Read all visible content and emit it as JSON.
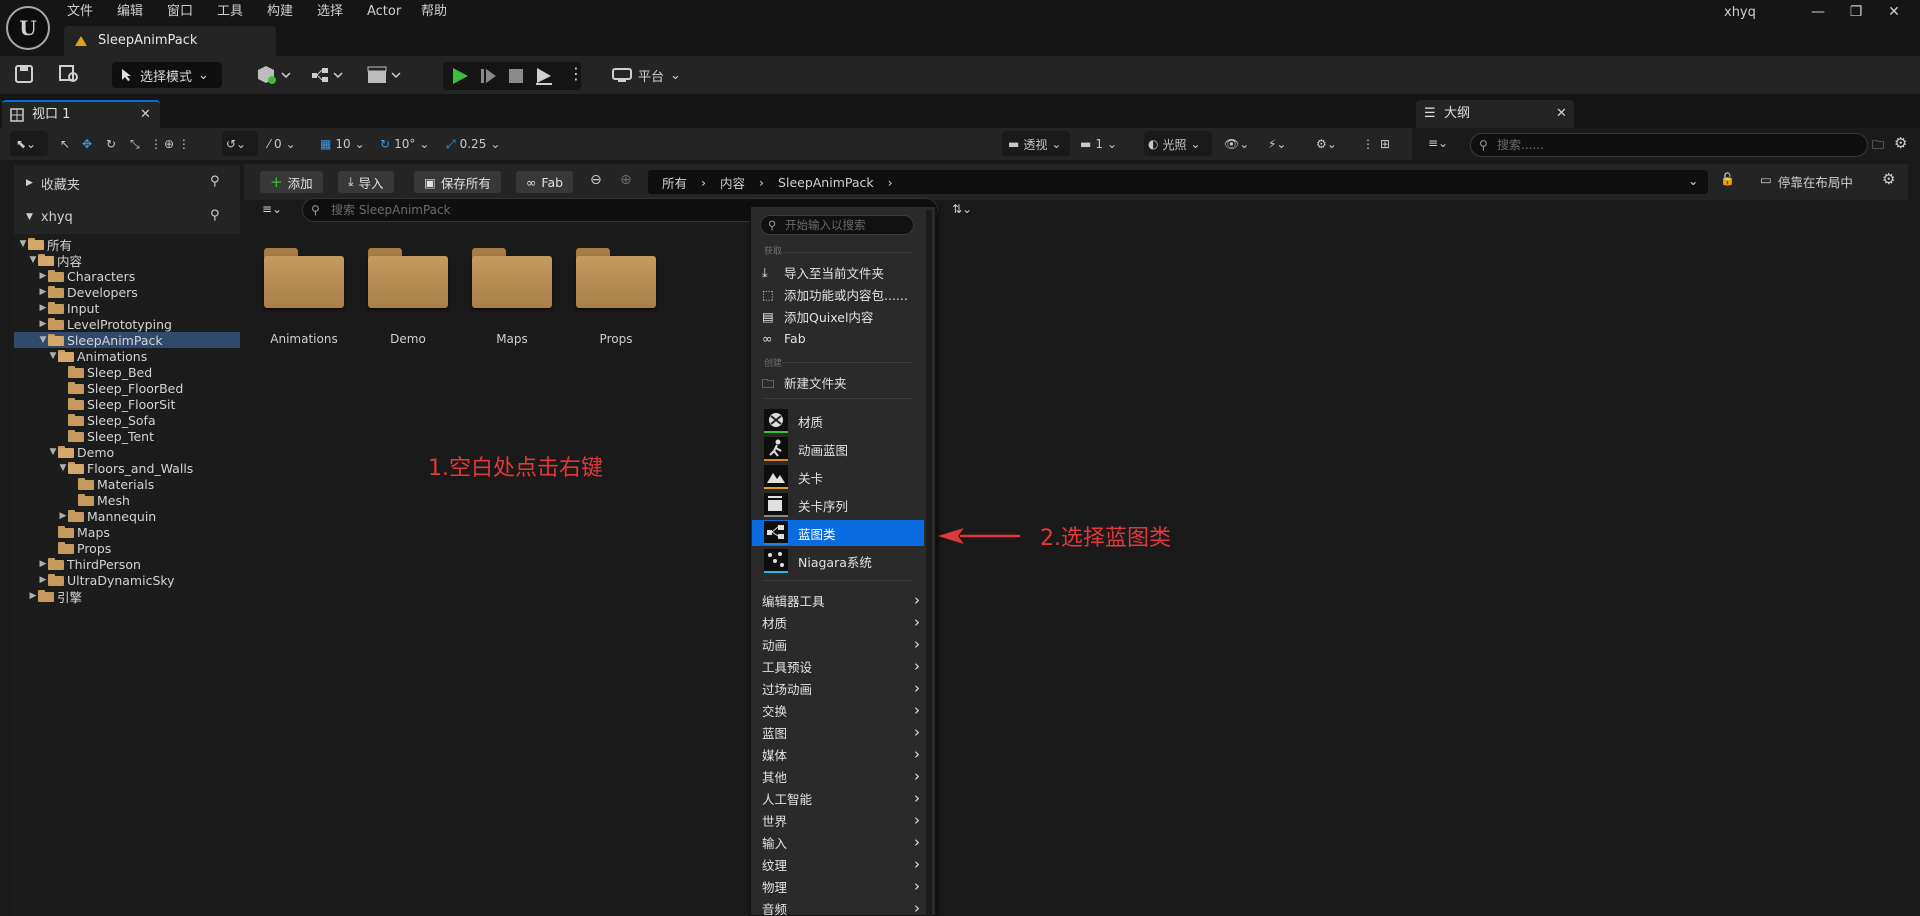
{
  "menubar": {
    "items": [
      "文件",
      "编辑",
      "窗口",
      "工具",
      "构建",
      "选择",
      "Actor",
      "帮助"
    ],
    "user": "xhyq",
    "project_tab": "SleepAnimPack"
  },
  "toolbar": {
    "mode_select": "选择模式",
    "platform": "平台"
  },
  "viewport": {
    "tab_title": "视口 1",
    "rotation_snap": "0",
    "grid_snap": "10",
    "angle_snap": "10°",
    "scale_snap": "0.25",
    "view_mode": "透视",
    "speed": "1",
    "lighting": "光照"
  },
  "outliner": {
    "tab_title": "大纲",
    "search_placeholder": "搜索......"
  },
  "content_browser": {
    "favorites": "收藏夹",
    "root": "xhyq",
    "buttons": {
      "add": "添加",
      "import": "导入",
      "save_all": "保存所有",
      "fab": "Fab"
    },
    "path": [
      "所有",
      "内容",
      "SleepAnimPack"
    ],
    "dock_label": "停靠在布局中",
    "search_placeholder": "搜索 SleepAnimPack",
    "tree": [
      {
        "label": "所有",
        "depth": 0,
        "expanded": true,
        "selected": false,
        "arrow": true
      },
      {
        "label": "内容",
        "depth": 1,
        "expanded": true,
        "selected": false,
        "arrow": true
      },
      {
        "label": "Characters",
        "depth": 2,
        "expanded": false,
        "selected": false,
        "arrow": true
      },
      {
        "label": "Developers",
        "depth": 2,
        "expanded": false,
        "selected": false,
        "arrow": true
      },
      {
        "label": "Input",
        "depth": 2,
        "expanded": false,
        "selected": false,
        "arrow": true
      },
      {
        "label": "LevelPrototyping",
        "depth": 2,
        "expanded": false,
        "selected": false,
        "arrow": true
      },
      {
        "label": "SleepAnimPack",
        "depth": 2,
        "expanded": true,
        "selected": true,
        "arrow": true
      },
      {
        "label": "Animations",
        "depth": 3,
        "expanded": true,
        "selected": false,
        "arrow": true
      },
      {
        "label": "Sleep_Bed",
        "depth": 4,
        "expanded": false,
        "selected": false,
        "arrow": false
      },
      {
        "label": "Sleep_FloorBed",
        "depth": 4,
        "expanded": false,
        "selected": false,
        "arrow": false
      },
      {
        "label": "Sleep_FloorSit",
        "depth": 4,
        "expanded": false,
        "selected": false,
        "arrow": false
      },
      {
        "label": "Sleep_Sofa",
        "depth": 4,
        "expanded": false,
        "selected": false,
        "arrow": false
      },
      {
        "label": "Sleep_Tent",
        "depth": 4,
        "expanded": false,
        "selected": false,
        "arrow": false
      },
      {
        "label": "Demo",
        "depth": 3,
        "expanded": true,
        "selected": false,
        "arrow": true
      },
      {
        "label": "Floors_and_Walls",
        "depth": 4,
        "expanded": true,
        "selected": false,
        "arrow": true
      },
      {
        "label": "Materials",
        "depth": 5,
        "expanded": false,
        "selected": false,
        "arrow": false
      },
      {
        "label": "Mesh",
        "depth": 5,
        "expanded": false,
        "selected": false,
        "arrow": false
      },
      {
        "label": "Mannequin",
        "depth": 4,
        "expanded": false,
        "selected": false,
        "arrow": true
      },
      {
        "label": "Maps",
        "depth": 3,
        "expanded": false,
        "selected": false,
        "arrow": false
      },
      {
        "label": "Props",
        "depth": 3,
        "expanded": false,
        "selected": false,
        "arrow": false
      },
      {
        "label": "ThirdPerson",
        "depth": 2,
        "expanded": false,
        "selected": false,
        "arrow": true
      },
      {
        "label": "UltraDynamicSky",
        "depth": 2,
        "expanded": false,
        "selected": false,
        "arrow": true
      },
      {
        "label": "引擎",
        "depth": 1,
        "expanded": false,
        "selected": false,
        "arrow": true
      }
    ],
    "assets": [
      "Animations",
      "Demo",
      "Maps",
      "Props"
    ]
  },
  "context_menu": {
    "search_placeholder": "开始输入以搜索",
    "section_get": "获取",
    "section_create": "创建",
    "get_items": [
      "导入至当前文件夹",
      "添加功能或内容包......",
      "添加Quixel内容",
      "Fab"
    ],
    "new_folder": "新建文件夹",
    "asset_items": [
      {
        "label": "材质",
        "color": "#3dbd3d",
        "highlighted": false
      },
      {
        "label": "动画蓝图",
        "color": "#e08a1a",
        "highlighted": false
      },
      {
        "label": "关卡",
        "color": "#e0a21a",
        "highlighted": false
      },
      {
        "label": "关卡序列",
        "color": "#888888",
        "highlighted": false
      },
      {
        "label": "蓝图类",
        "color": "#2a7de0",
        "highlighted": true
      },
      {
        "label": "Niagara系统",
        "color": "#2ab8e0",
        "highlighted": false
      }
    ],
    "submenus": [
      "编辑器工具",
      "材质",
      "动画",
      "工具预设",
      "过场动画",
      "交换",
      "蓝图",
      "媒体",
      "其他",
      "人工智能",
      "世界",
      "输入",
      "纹理",
      "物理",
      "音频"
    ]
  },
  "annotations": {
    "step1": "1.空白处点击右键",
    "step2": "2.选择蓝图类",
    "color": "#e0383b"
  }
}
